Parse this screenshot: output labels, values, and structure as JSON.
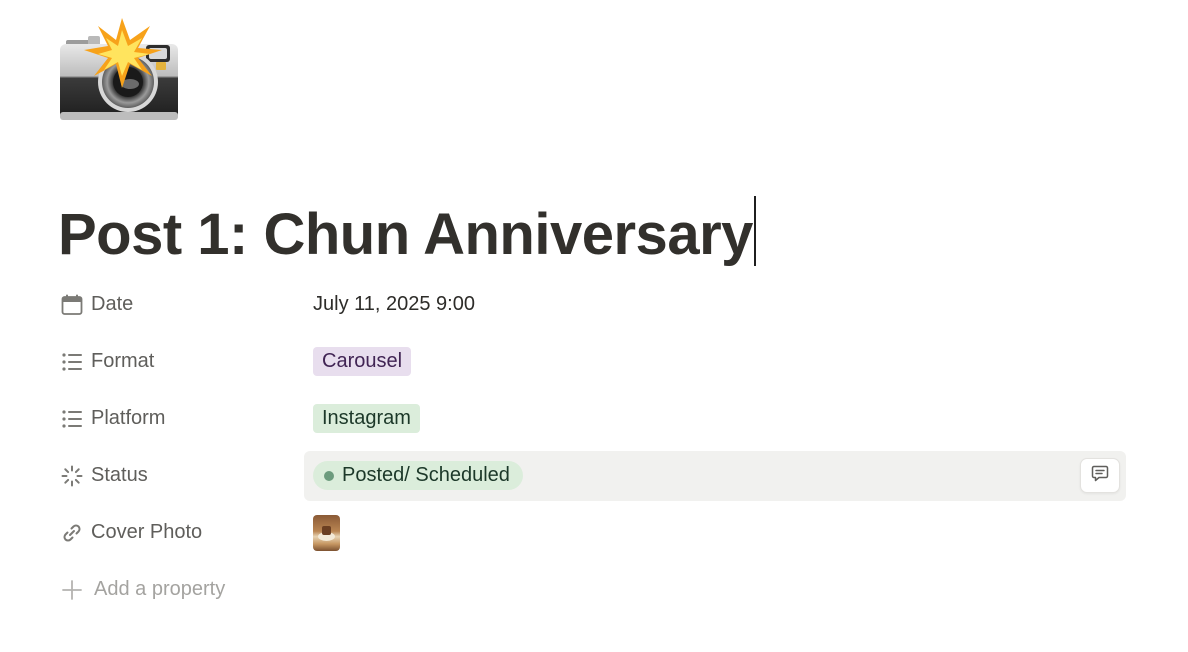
{
  "page": {
    "title": "Post 1: Chun Anniversary",
    "icon": "camera-with-flash-icon"
  },
  "properties": [
    {
      "name": "Date",
      "icon": "calendar-icon",
      "value": "July 11, 2025 9:00"
    },
    {
      "name": "Format",
      "icon": "list-icon",
      "value": "Carousel",
      "color": "#e8deee"
    },
    {
      "name": "Platform",
      "icon": "list-icon",
      "value": "Instagram",
      "color": "#dbeddb"
    },
    {
      "name": "Status",
      "icon": "status-icon",
      "value": "Posted/ Scheduled",
      "dot_color": "#6c9b7d"
    },
    {
      "name": "Cover Photo",
      "icon": "link-icon",
      "value": "thumbnail-image"
    }
  ],
  "add_property": {
    "label": "Add a property",
    "icon": "plus-icon"
  },
  "comment_button": {
    "icon": "comment-icon"
  }
}
